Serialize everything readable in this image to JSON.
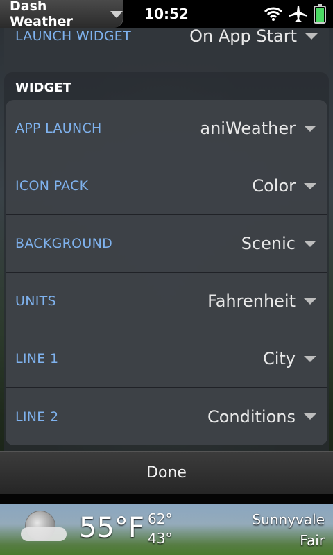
{
  "status_bar": {
    "app_title": "Dash Weather",
    "time": "10:52",
    "icons": [
      "wifi-icon",
      "airplane-icon",
      "battery-icon"
    ]
  },
  "top_section": {
    "partial_label": "LAUNCH WIDGET",
    "partial_value": "On App Start"
  },
  "widget_group": {
    "title": "WIDGET",
    "rows": [
      {
        "label": "APP LAUNCH",
        "value": "aniWeather"
      },
      {
        "label": "ICON PACK",
        "value": "Color"
      },
      {
        "label": "BACKGROUND",
        "value": "Scenic"
      },
      {
        "label": "UNITS",
        "value": "Fahrenheit"
      },
      {
        "label": "LINE 1",
        "value": "City"
      },
      {
        "label": "LINE 2",
        "value": "Conditions"
      }
    ]
  },
  "command_bar": {
    "done_label": "Done"
  },
  "dashboard": {
    "temperature": "55°F",
    "high": "62°",
    "low": "43°",
    "city": "Sunnyvale",
    "conditions": "Fair",
    "icon": "moon-cloud-icon"
  },
  "colors": {
    "label_blue": "#7fb2ee",
    "value_text": "#e8e8e8",
    "battery_green": "#4cd964"
  }
}
